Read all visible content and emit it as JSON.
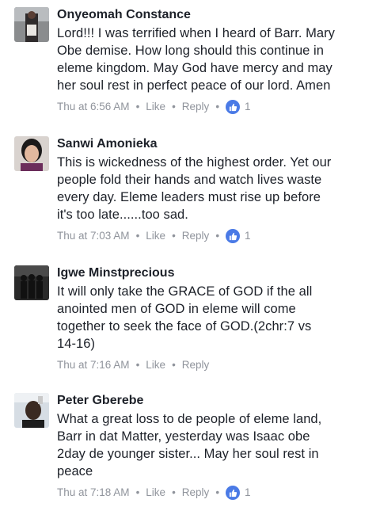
{
  "comments": [
    {
      "author": "Onyeomah Constance",
      "lines": [
        "Lord!!! I was terrified when I heard of Barr. Mary",
        "Obe demise. How long should this continue in",
        "eleme kingdom. May God have mercy and may",
        "her soul rest in perfect peace of our lord. Amen"
      ],
      "time": "Thu at 6:56 AM",
      "like_label": "Like",
      "reply_label": "Reply",
      "likes": "1"
    },
    {
      "author": "Sanwi Amonieka",
      "lines": [
        "This is wickedness of the highest order. Yet our",
        "people fold their hands and watch lives waste",
        "every day. Eleme leaders must rise up before",
        "it's too late......too sad."
      ],
      "time": "Thu at 7:03 AM",
      "like_label": "Like",
      "reply_label": "Reply",
      "likes": "1"
    },
    {
      "author": "Igwe Minstprecious",
      "lines": [
        "It will only take the GRACE of GOD if the all",
        "anointed men of GOD in eleme will come",
        "together to seek the face of GOD.(2chr:7 vs",
        "14-16)"
      ],
      "time": "Thu at 7:16 AM",
      "like_label": "Like",
      "reply_label": "Reply"
    },
    {
      "author": "Peter Gberebe",
      "lines": [
        "What a great loss to de people of eleme land,",
        "Barr in dat Matter, yesterday was Isaac obe",
        "2day de younger sister... May her soul rest in",
        "peace"
      ],
      "time": "Thu at 7:18 AM",
      "like_label": "Like",
      "reply_label": "Reply",
      "likes": "1"
    }
  ],
  "separator": "•",
  "colors": {
    "like_badge": "#4a7ae6",
    "meta": "#90949c",
    "text": "#1d2129"
  }
}
